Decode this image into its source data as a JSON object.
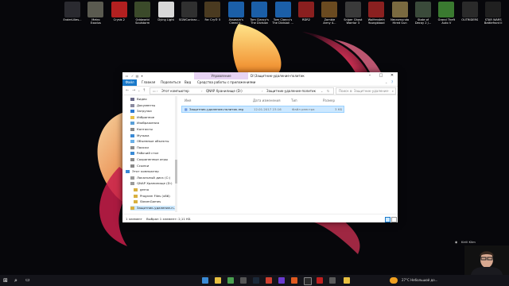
{
  "desktop": {
    "icons": [
      {
        "label": "EnderLilies...",
        "color": "#2a2a30"
      },
      {
        "label": "Metro\nExodus",
        "color": "#5a5a50"
      },
      {
        "label": "Crysis 2",
        "color": "#b22020"
      },
      {
        "label": "Oddworld\nSoulstorm",
        "color": "#3b4a2a"
      },
      {
        "label": "Dying Light",
        "color": "#d8d8d8"
      },
      {
        "label": "SGWContrac...",
        "color": "#303030"
      },
      {
        "label": "Far Cry® 5",
        "color": "#4a3a20"
      },
      {
        "label": "Assassin's\nCreed V...",
        "color": "#1b5fa8"
      },
      {
        "label": "Tom Clancy's\nThe Division",
        "color": "#1b5fa8"
      },
      {
        "label": "Tom Clancy's\nThe Division ...",
        "color": "#1b5fa8"
      },
      {
        "label": "RDR2",
        "color": "#8a1f1f"
      },
      {
        "label": "Zombie\nArmy 4...",
        "color": "#6a4a20"
      },
      {
        "label": "Sniper Ghost\nWarrior 3",
        "color": "#3a3a3a"
      },
      {
        "label": "Wolfenstein\nYoungblood",
        "color": "#8a2020"
      },
      {
        "label": "Necromunda\nHired Gun",
        "color": "#7a6a40"
      },
      {
        "label": "State of\nDecay 2 J...",
        "color": "#3a4a3a"
      },
      {
        "label": "Grand Theft\nAuto V",
        "color": "#3a7a30"
      },
      {
        "label": "OUTRIDERS",
        "color": "#2a2a2a"
      },
      {
        "label": "STAR WARS\nBattlefront II",
        "color": "#202020"
      }
    ]
  },
  "window": {
    "title": "D:\\Защитник-удаление-политик",
    "context_tab": "Управление",
    "ribbon_tabs": [
      "Файл",
      "Главная",
      "Поделиться",
      "Вид",
      "Средства работы с приложениями"
    ],
    "breadcrumbs": [
      "Этот компьютер",
      "QNAP Хранилище (D:)",
      "Защитник-удаление-политик"
    ],
    "search_placeholder": "Поиск в: Защитник-удаление-поли...",
    "nav_items": [
      {
        "label": "Видео",
        "color": "#6a6a8a"
      },
      {
        "label": "Документы",
        "color": "#8a8aa0"
      },
      {
        "label": "Загрузки",
        "color": "#2a7ad5"
      },
      {
        "label": "Избранное",
        "color": "#e8c04a"
      },
      {
        "label": "Изображения",
        "color": "#5aa0d8"
      },
      {
        "label": "Контакты",
        "color": "#8a8a8a"
      },
      {
        "label": "Музыка",
        "color": "#3a8ad5"
      },
      {
        "label": "Объемные объекты",
        "color": "#6ab0e8"
      },
      {
        "label": "Поиски",
        "color": "#8a8a8a"
      },
      {
        "label": "Рабочий стол",
        "color": "#3a8ad5"
      },
      {
        "label": "Сохраненные игры",
        "color": "#8a8a8a"
      },
      {
        "label": "Ссылки",
        "color": "#8a8a8a"
      },
      {
        "label": "Этот компьютер",
        "color": "#3a8ad5"
      },
      {
        "label": "Локальный диск (C:)",
        "color": "#9a9a9a"
      },
      {
        "label": "QNAP Хранилище (D:)",
        "color": "#9a9a9a"
      },
      {
        "label": "gerno",
        "color": "#d8b040"
      },
      {
        "label": "Program Files (x86)",
        "color": "#d8b040"
      },
      {
        "label": "SteamGames",
        "color": "#d8b040"
      },
      {
        "label": "Защитник-удаление-п...",
        "color": "#d8b040"
      }
    ],
    "columns": [
      "Имя",
      "Дата изменения",
      "Тип",
      "Размер"
    ],
    "file": {
      "name": "Защитник-удаление-политик.reg",
      "date": "12.01.2017 23:16",
      "type": "Файл реестра",
      "size": "3 КБ"
    },
    "status": {
      "count": "1 элемент",
      "selected": "Выбран 1 элемент: 2,11 КБ"
    }
  },
  "webcam": {
    "label": "Kirill Klim"
  },
  "taskbar": {
    "weather": "27°C  Небольшой до..."
  }
}
